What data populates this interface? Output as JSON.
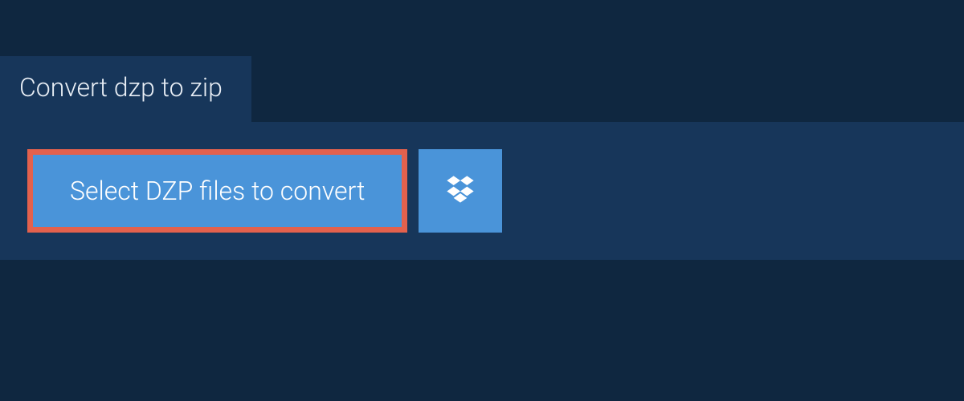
{
  "tab": {
    "label": "Convert dzp to zip"
  },
  "actions": {
    "select_files_label": "Select DZP files to convert"
  },
  "colors": {
    "background": "#0f2740",
    "panel": "#17365a",
    "button": "#4a94d9",
    "highlight_border": "#e3614d",
    "text_light": "#ffffff"
  }
}
